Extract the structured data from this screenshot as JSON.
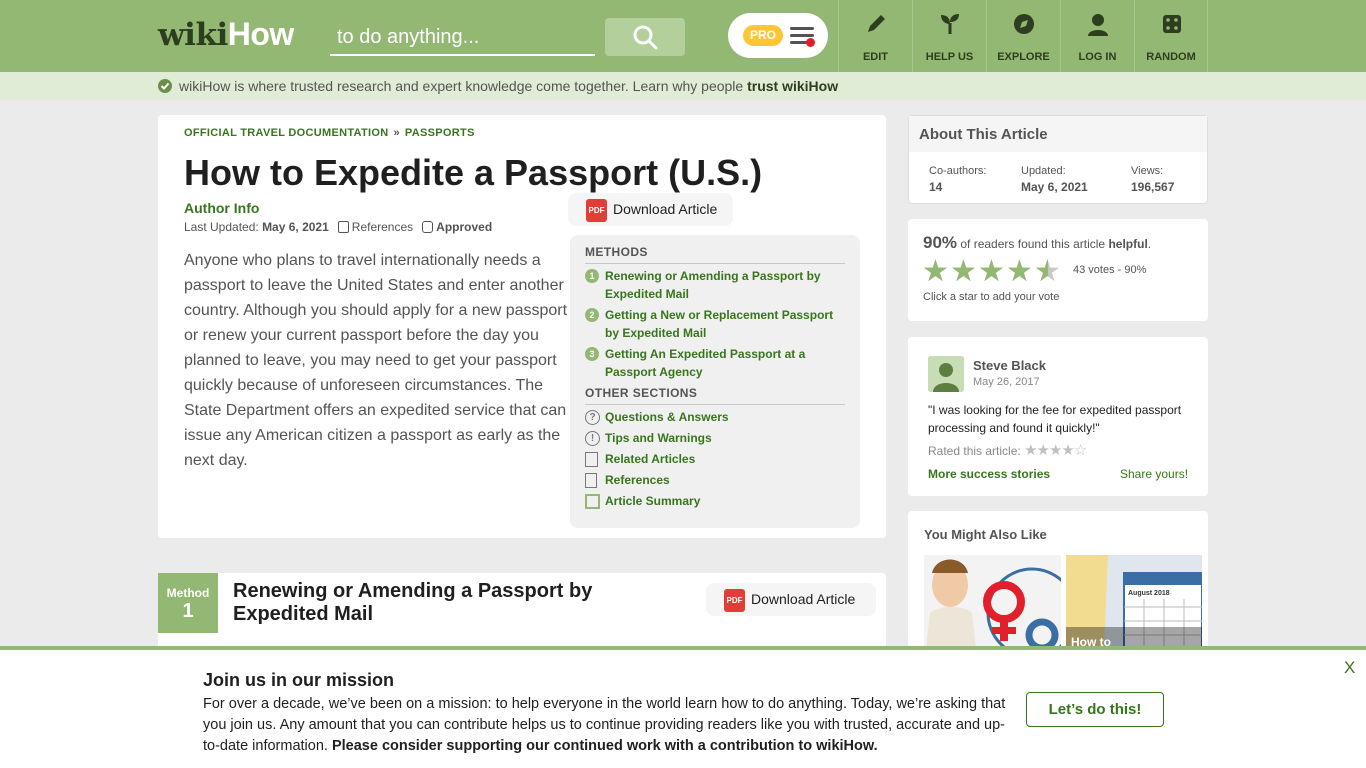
{
  "header": {
    "logo_part1": "wiki",
    "logo_part2": "How",
    "search_placeholder": "to do anything...",
    "pro_label": "PRO",
    "nav": [
      "EDIT",
      "HELP US",
      "EXPLORE",
      "LOG IN",
      "RANDOM"
    ]
  },
  "trust_bar": {
    "text": "wikiHow is where trusted research and expert knowledge come together. Learn why people ",
    "link": "trust wikiHow"
  },
  "article": {
    "breadcrumb": [
      "OFFICIAL TRAVEL DOCUMENTATION",
      "PASSPORTS"
    ],
    "breadcrumb_sep": "»",
    "title": "How to Expedite a Passport (U.S.)",
    "author_info": "Author Info",
    "last_updated_label": "Last Updated:",
    "last_updated": "May 6, 2021",
    "references_label": "References",
    "approved_label": "Approved",
    "download_label": "Download Article",
    "pdf_label": "PDF",
    "intro": "Anyone who plans to travel internationally needs a passport to leave the United States and enter another country. Although you should apply for a new passport or renew your current passport before the day you planned to leave, you may need to get your passport quickly because of unforeseen circumstances. The State Department offers an expedited service that can issue any American citizen a passport as early as the next day."
  },
  "toc": {
    "methods_heading": "METHODS",
    "methods": [
      {
        "num": "1",
        "label": "Renewing or Amending a Passport by Expedited Mail"
      },
      {
        "num": "2",
        "label": "Getting a New or Replacement Passport by Expedited Mail"
      },
      {
        "num": "3",
        "label": "Getting An Expedited Passport at a Passport Agency"
      }
    ],
    "other_heading": "OTHER SECTIONS",
    "other": [
      {
        "icon": "question-icon",
        "label": "Questions & Answers"
      },
      {
        "icon": "warning-icon",
        "label": "Tips and Warnings"
      },
      {
        "icon": "document-icon",
        "label": "Related Articles"
      },
      {
        "icon": "bookmark-icon",
        "label": "References"
      },
      {
        "icon": "summary-icon",
        "label": "Article Summary"
      }
    ]
  },
  "method1": {
    "label": "Method",
    "number": "1",
    "title": "Renewing or Amending a Passport by Expedited Mail",
    "download_label": "Download Article"
  },
  "sidebar": {
    "about_title": "About This Article",
    "coauthors_label": "Co-authors:",
    "coauthors": "14",
    "updated_label": "Updated:",
    "updated": "May 6, 2021",
    "views_label": "Views:",
    "views": "196,567",
    "helpful_pct": "90%",
    "helpful_text_1": " of readers found this article ",
    "helpful_word": "helpful",
    "helpful_end": ".",
    "rating_fraction": 0.9,
    "votes": "43 votes - 90%",
    "vote_hint": "Click a star to add your vote",
    "review_name": "Steve Black",
    "review_date": "May 26, 2017",
    "review_quote": "\"I was looking for the fee for expedited passport processing and found it quickly!\"",
    "rated_label": "Rated this article:",
    "review_stars": 4,
    "more_stories": "More success stories",
    "share_yours": "Share yours!",
    "yml_title": "You Might Also Like",
    "thumb_caption": "How to"
  },
  "banner": {
    "title": "Join us in our mission",
    "text": "For over a decade, we’ve been on a mission: to help everyone in the world learn how to do anything. Today, we’re asking that you join us. Any amount that you can contribute helps us to continue providing readers like you with trusted, accurate and up-to-date information. ",
    "text_bold": "Please consider supporting our continued work with a contribution to wikiHow.",
    "button": "Let’s do this!",
    "close": "X"
  },
  "colors": {
    "brand_green": "#93b874",
    "link_green": "#38761d",
    "dark_green": "#2d3e1f",
    "pro_yellow": "#ffc535",
    "pdf_red": "#e33d37"
  }
}
